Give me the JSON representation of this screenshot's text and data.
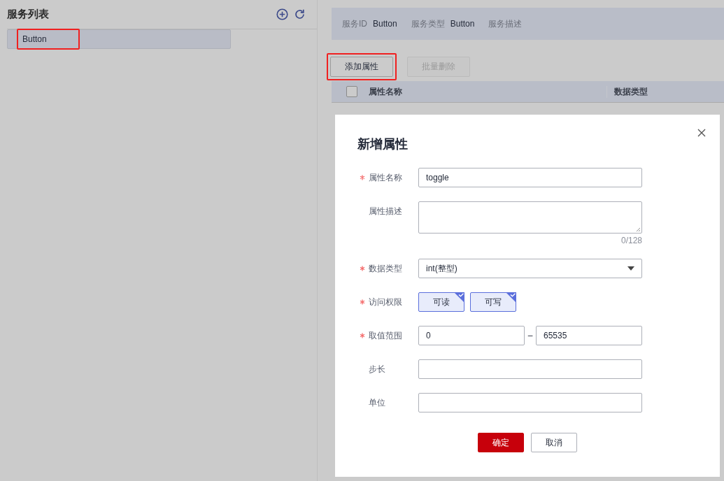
{
  "sidebar": {
    "title": "服务列表",
    "items": [
      {
        "label": "Button",
        "selected": true,
        "highlighted": true
      }
    ]
  },
  "service_info": [
    {
      "label": "服务ID",
      "value": "Button"
    },
    {
      "label": "服务类型",
      "value": "Button"
    },
    {
      "label": "服务描述"
    }
  ],
  "toolbar": [
    {
      "label": "添加属性",
      "disabled": false,
      "highlighted": true
    },
    {
      "label": "批量删除",
      "disabled": true,
      "highlighted": false
    }
  ],
  "table": {
    "select_all_checked": false,
    "columns": [
      "属性名称",
      "数据类型"
    ]
  },
  "dialog": {
    "title": "新增属性",
    "fields": [
      {
        "kind": "text",
        "label": "属性名称",
        "required": true,
        "value": "toggle"
      },
      {
        "kind": "textarea",
        "label": "属性描述",
        "required": false,
        "counter": "0/128"
      },
      {
        "kind": "select",
        "label": "数据类型",
        "required": true,
        "value": "int(整型)"
      },
      {
        "kind": "chips",
        "label": "访问权限",
        "required": true,
        "options": [
          {
            "label": "可读",
            "checked": true
          },
          {
            "label": "可写",
            "checked": true
          }
        ]
      },
      {
        "kind": "range",
        "label": "取值范围",
        "required": true,
        "min": "0",
        "separator": "–",
        "max": "65535"
      },
      {
        "kind": "text",
        "label": "步长",
        "required": false
      },
      {
        "kind": "text",
        "label": "单位",
        "required": false
      }
    ],
    "buttons": [
      {
        "label": "确定",
        "kind": "primary"
      },
      {
        "label": "取消",
        "kind": "secondary"
      }
    ]
  }
}
